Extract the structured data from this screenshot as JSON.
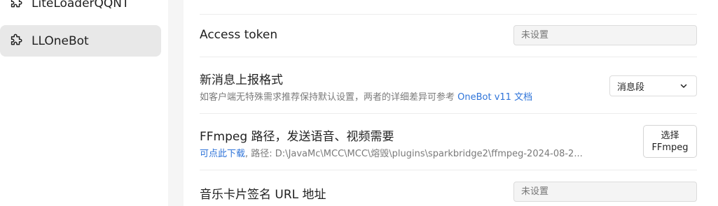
{
  "sidebar": {
    "items": [
      {
        "label": "LiteLoaderQQNT",
        "icon": "puzzle-icon",
        "active": false
      },
      {
        "label": "LLOneBot",
        "icon": "puzzle-icon",
        "active": true
      }
    ]
  },
  "settings": {
    "access_token": {
      "title": "Access token",
      "placeholder": "未设置"
    },
    "message_format": {
      "title": "新消息上报格式",
      "description": "如客户端无特殊需求推荐保持默认设置，两者的详细差异可参考 ",
      "link": "OneBot v11 文档",
      "selected": "消息段"
    },
    "ffmpeg": {
      "title": "FFmpeg 路径，发送语音、视频需要",
      "download_link": "可点此下载",
      "path_prefix": ", 路径: ",
      "path": "D:\\JavaMc\\MCC\\MCC\\熔毁\\plugins\\sparkbridge2\\ffmpeg-2024-08-2...",
      "button_line1": "选择",
      "button_line2": "FFmpeg"
    },
    "music_sign_url": {
      "title": "音乐卡片签名 URL 地址",
      "placeholder": "未设置"
    }
  },
  "colors": {
    "accent": "#2f74d9",
    "sidebar_active": "#e8e8e8",
    "divider_bg": "#f5f5f5"
  }
}
